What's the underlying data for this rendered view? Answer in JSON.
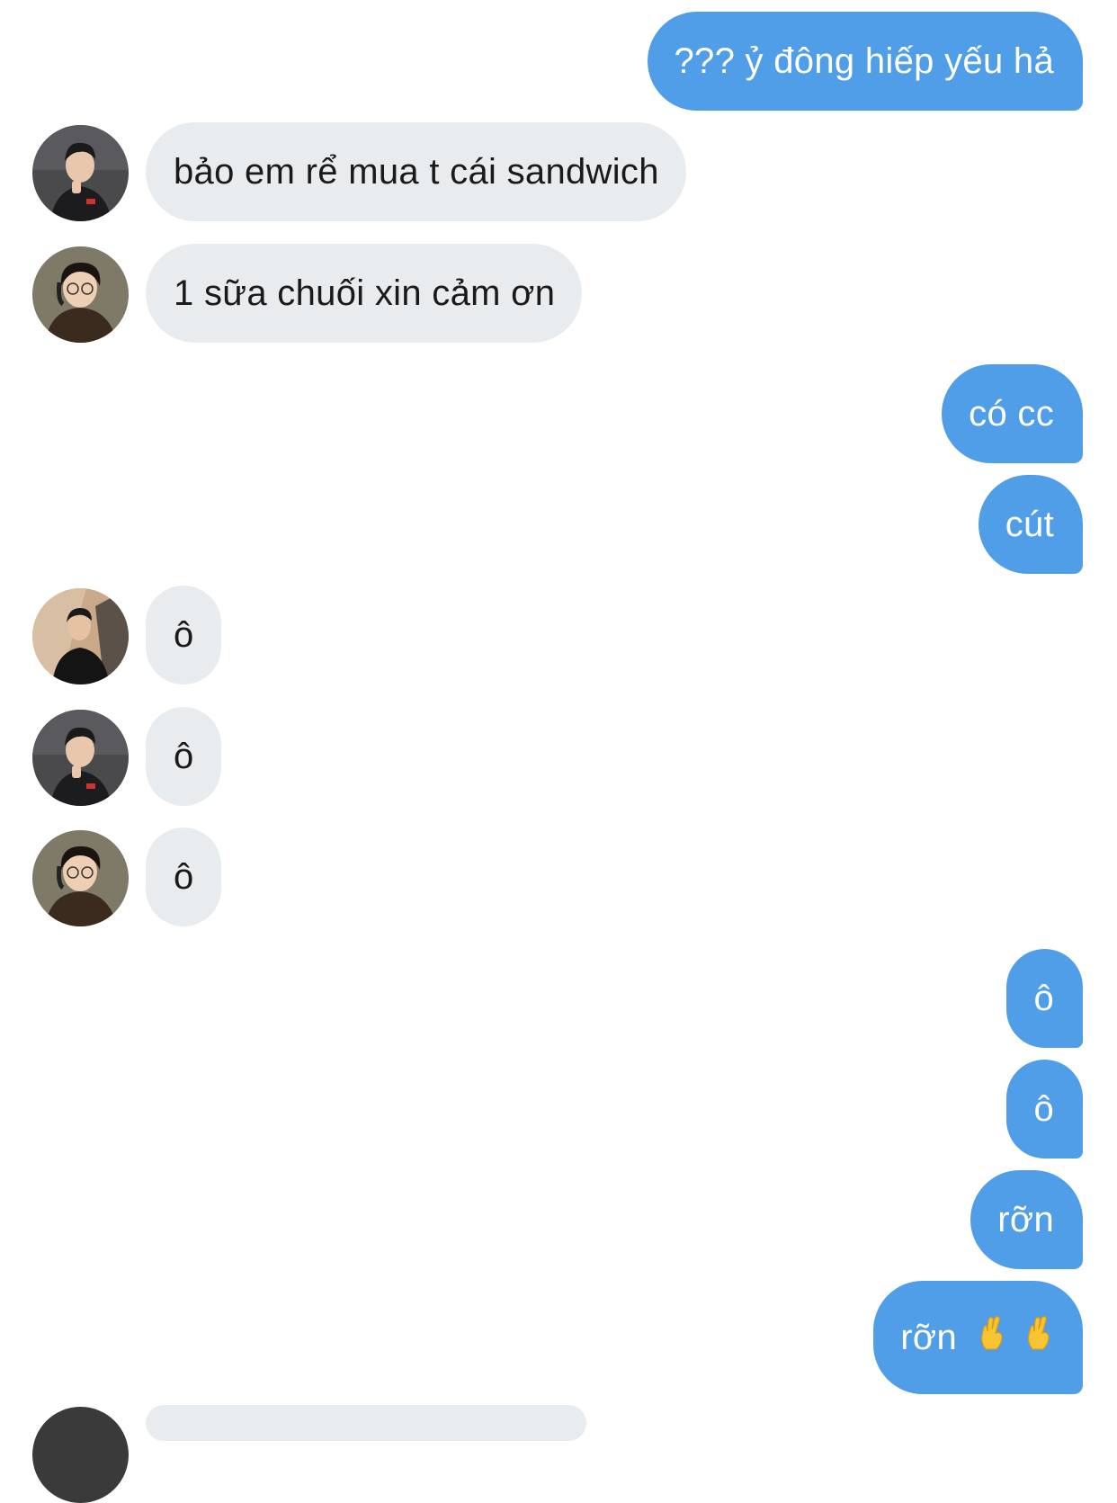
{
  "conversation": {
    "messages": [
      {
        "side": "out",
        "text": "??? ỷ đông hiếp yếu hả"
      },
      {
        "side": "in",
        "avatar": "avatar-a",
        "text": "bảo em rể mua t cái sandwich"
      },
      {
        "side": "in",
        "avatar": "avatar-b",
        "text": "1 sữa chuối xin cảm ơn"
      },
      {
        "side": "out",
        "text": "có cc"
      },
      {
        "side": "out",
        "text": "cút"
      },
      {
        "side": "in",
        "avatar": "avatar-c",
        "text": "ô"
      },
      {
        "side": "in",
        "avatar": "avatar-a",
        "text": "ô"
      },
      {
        "side": "in",
        "avatar": "avatar-b",
        "text": "ô"
      },
      {
        "side": "out",
        "text": "ô"
      },
      {
        "side": "out",
        "text": "ô"
      },
      {
        "side": "out",
        "text": "rỡn"
      },
      {
        "side": "out",
        "text": "rỡn",
        "emoji": [
          "crossed-fingers-icon",
          "crossed-fingers-icon"
        ]
      }
    ]
  },
  "colors": {
    "outgoing_bubble": "#4f9ee7",
    "incoming_bubble": "#e9ecef",
    "background": "#ffffff"
  }
}
